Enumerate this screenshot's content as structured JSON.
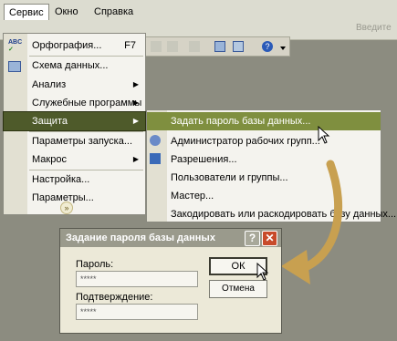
{
  "menubar": {
    "items": [
      {
        "label": "Сервис"
      },
      {
        "label": "Окно"
      },
      {
        "label": "Справка"
      }
    ],
    "help_search_placeholder": "Введите"
  },
  "main_menu": {
    "items": [
      {
        "label": "Орфография...",
        "shortcut": "F7"
      },
      {
        "label": "Схема данных..."
      },
      {
        "label": "Анализ",
        "submenu": true
      },
      {
        "label": "Служебные программы",
        "submenu": true
      },
      {
        "label": "Защита",
        "submenu": true
      },
      {
        "label": "Параметры запуска..."
      },
      {
        "label": "Макрос",
        "submenu": true
      },
      {
        "label": "Настройка..."
      },
      {
        "label": "Параметры..."
      }
    ],
    "expand_glyph": "»"
  },
  "sub_menu": {
    "items": [
      {
        "label": "Задать пароль базы данных..."
      },
      {
        "label": "Администратор рабочих групп..."
      },
      {
        "label": "Разрешения..."
      },
      {
        "label": "Пользователи и группы..."
      },
      {
        "label": "Мастер..."
      },
      {
        "label": "Закодировать или раскодировать базу данных..."
      }
    ]
  },
  "dialog": {
    "title": "Задание пароля базы данных",
    "password_label": "Пароль:",
    "password_value": "*****",
    "confirm_label": "Подтверждение:",
    "confirm_value": "*****",
    "ok_label": "ОК",
    "cancel_label": "Отмена",
    "help_glyph": "?",
    "close_glyph": "✕"
  },
  "colors": {
    "highlight": "#7f8f3f",
    "arrow": "#c8a050",
    "workspace": "#8c8c80"
  }
}
